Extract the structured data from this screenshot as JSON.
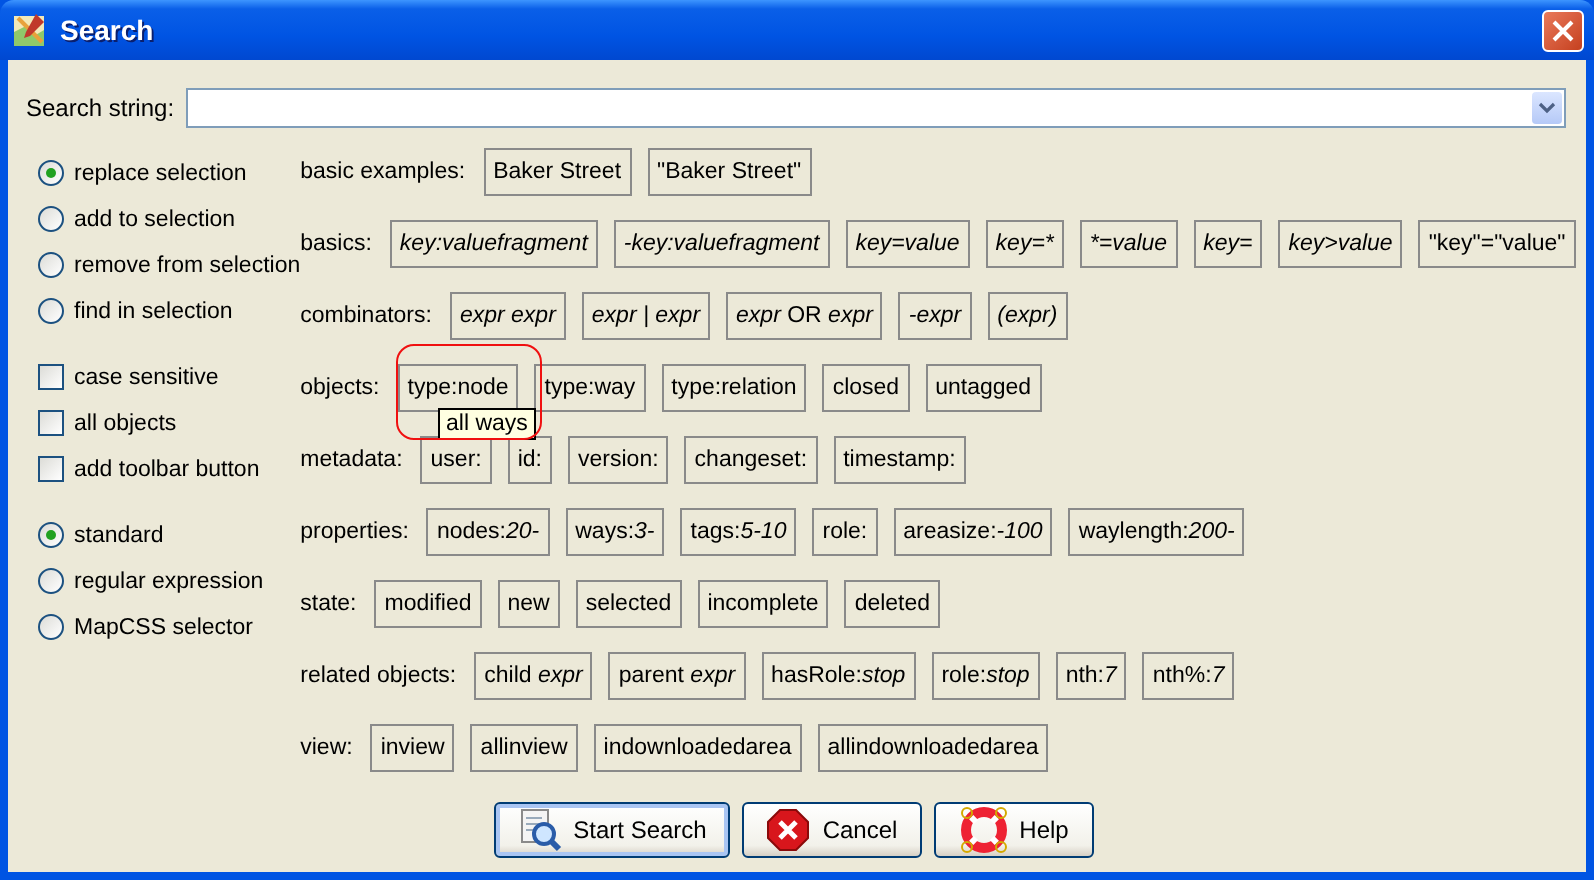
{
  "window": {
    "title": "Search"
  },
  "search_string": {
    "label": "Search string:"
  },
  "selection_modes": [
    {
      "label": "replace selection",
      "selected": true
    },
    {
      "label": "add to selection",
      "selected": false
    },
    {
      "label": "remove from selection",
      "selected": false
    },
    {
      "label": "find in selection",
      "selected": false
    }
  ],
  "options": [
    {
      "label": "case sensitive",
      "checked": false
    },
    {
      "label": "all objects",
      "checked": false
    },
    {
      "label": "add toolbar button",
      "checked": false
    }
  ],
  "syntax_modes": [
    {
      "label": "standard",
      "selected": true
    },
    {
      "label": "regular expression",
      "selected": false
    },
    {
      "label": "MapCSS selector",
      "selected": false
    }
  ],
  "example_rows": [
    {
      "label": "basic examples:",
      "chips": [
        {
          "text": "Baker Street",
          "italic": false
        },
        {
          "text": "\"Baker Street\"",
          "italic": false
        }
      ]
    },
    {
      "label": "basics:",
      "chips": [
        {
          "text": "key:valuefragment",
          "italic": true
        },
        {
          "text": "-key:valuefragment",
          "italic": true
        },
        {
          "text": "key=value",
          "italic": true
        },
        {
          "text": "key=*",
          "italic": true
        },
        {
          "text": "*=value",
          "italic": true
        },
        {
          "text": "key=",
          "italic": true
        },
        {
          "text": "key>value",
          "italic": true
        },
        {
          "text": "\"key\"=\"value\"",
          "italic": false
        }
      ]
    },
    {
      "label": "combinators:",
      "chips": [
        {
          "text": "expr expr",
          "italic": true
        },
        {
          "text": "expr | expr",
          "italic": true
        },
        {
          "text": "*expr* OR *expr*",
          "italic": false
        },
        {
          "text": "-expr",
          "italic": true
        },
        {
          "text": "(expr)",
          "italic": true
        }
      ]
    },
    {
      "label": "objects:",
      "chips": [
        {
          "text": "type:node",
          "italic": false
        },
        {
          "text": "type:way",
          "italic": false
        },
        {
          "text": "type:relation",
          "italic": false
        },
        {
          "text": "closed",
          "italic": false
        },
        {
          "text": "untagged",
          "italic": false
        }
      ]
    },
    {
      "label": "metadata:",
      "chips": [
        {
          "text": "user:",
          "italic": false
        },
        {
          "text": "id:",
          "italic": false
        },
        {
          "text": "version:",
          "italic": false
        },
        {
          "text": "changeset:",
          "italic": false
        },
        {
          "text": "timestamp:",
          "italic": false
        }
      ]
    },
    {
      "label": "properties:",
      "chips": [
        {
          "text": "nodes:*20-*",
          "italic": false
        },
        {
          "text": "ways:*3-*",
          "italic": false
        },
        {
          "text": "tags:*5-10*",
          "italic": false
        },
        {
          "text": "role:",
          "italic": false
        },
        {
          "text": "areasize:*-100*",
          "italic": false
        },
        {
          "text": "waylength:*200-*",
          "italic": false
        }
      ]
    },
    {
      "label": "state:",
      "chips": [
        {
          "text": "modified",
          "italic": false
        },
        {
          "text": "new",
          "italic": false
        },
        {
          "text": "selected",
          "italic": false
        },
        {
          "text": "incomplete",
          "italic": false
        },
        {
          "text": "deleted",
          "italic": false
        }
      ]
    },
    {
      "label": "related objects:",
      "chips": [
        {
          "text": "child *expr*",
          "italic": false
        },
        {
          "text": "parent *expr*",
          "italic": false
        },
        {
          "text": "hasRole:*stop*",
          "italic": false
        },
        {
          "text": "role:*stop*",
          "italic": false
        },
        {
          "text": "nth:*7*",
          "italic": false
        },
        {
          "text": "nth%:*7*",
          "italic": false
        }
      ]
    },
    {
      "label": "view:",
      "chips": [
        {
          "text": "inview",
          "italic": false
        },
        {
          "text": "allinview",
          "italic": false
        },
        {
          "text": "indownloadedarea",
          "italic": false
        },
        {
          "text": "allindownloadedarea",
          "italic": false
        }
      ]
    }
  ],
  "tooltip": {
    "text": "all ways"
  },
  "buttons": [
    {
      "label": "Start Search",
      "kind": "search",
      "default": true
    },
    {
      "label": "Cancel",
      "kind": "cancel",
      "default": false
    },
    {
      "label": "Help",
      "kind": "help",
      "default": false
    }
  ]
}
